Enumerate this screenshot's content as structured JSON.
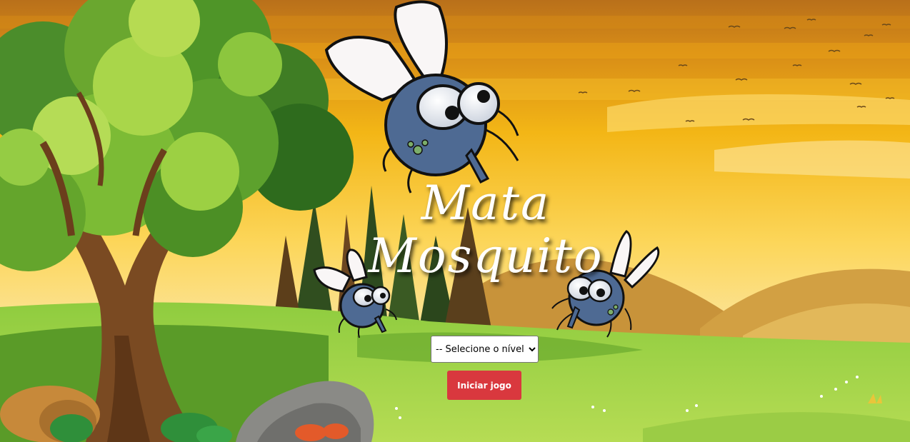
{
  "game": {
    "title_line1": "Mata",
    "title_line2": "Mosquito"
  },
  "level_select": {
    "selected": "-- Selecione o nível --"
  },
  "start_button": {
    "label": "Iniciar jogo",
    "color": "#d9383e"
  },
  "colors": {
    "sky_top": "#c9801a",
    "sky_bottom": "#fbe38a",
    "grass": "#7bc142",
    "mosquito_body": "#4e6a93"
  }
}
